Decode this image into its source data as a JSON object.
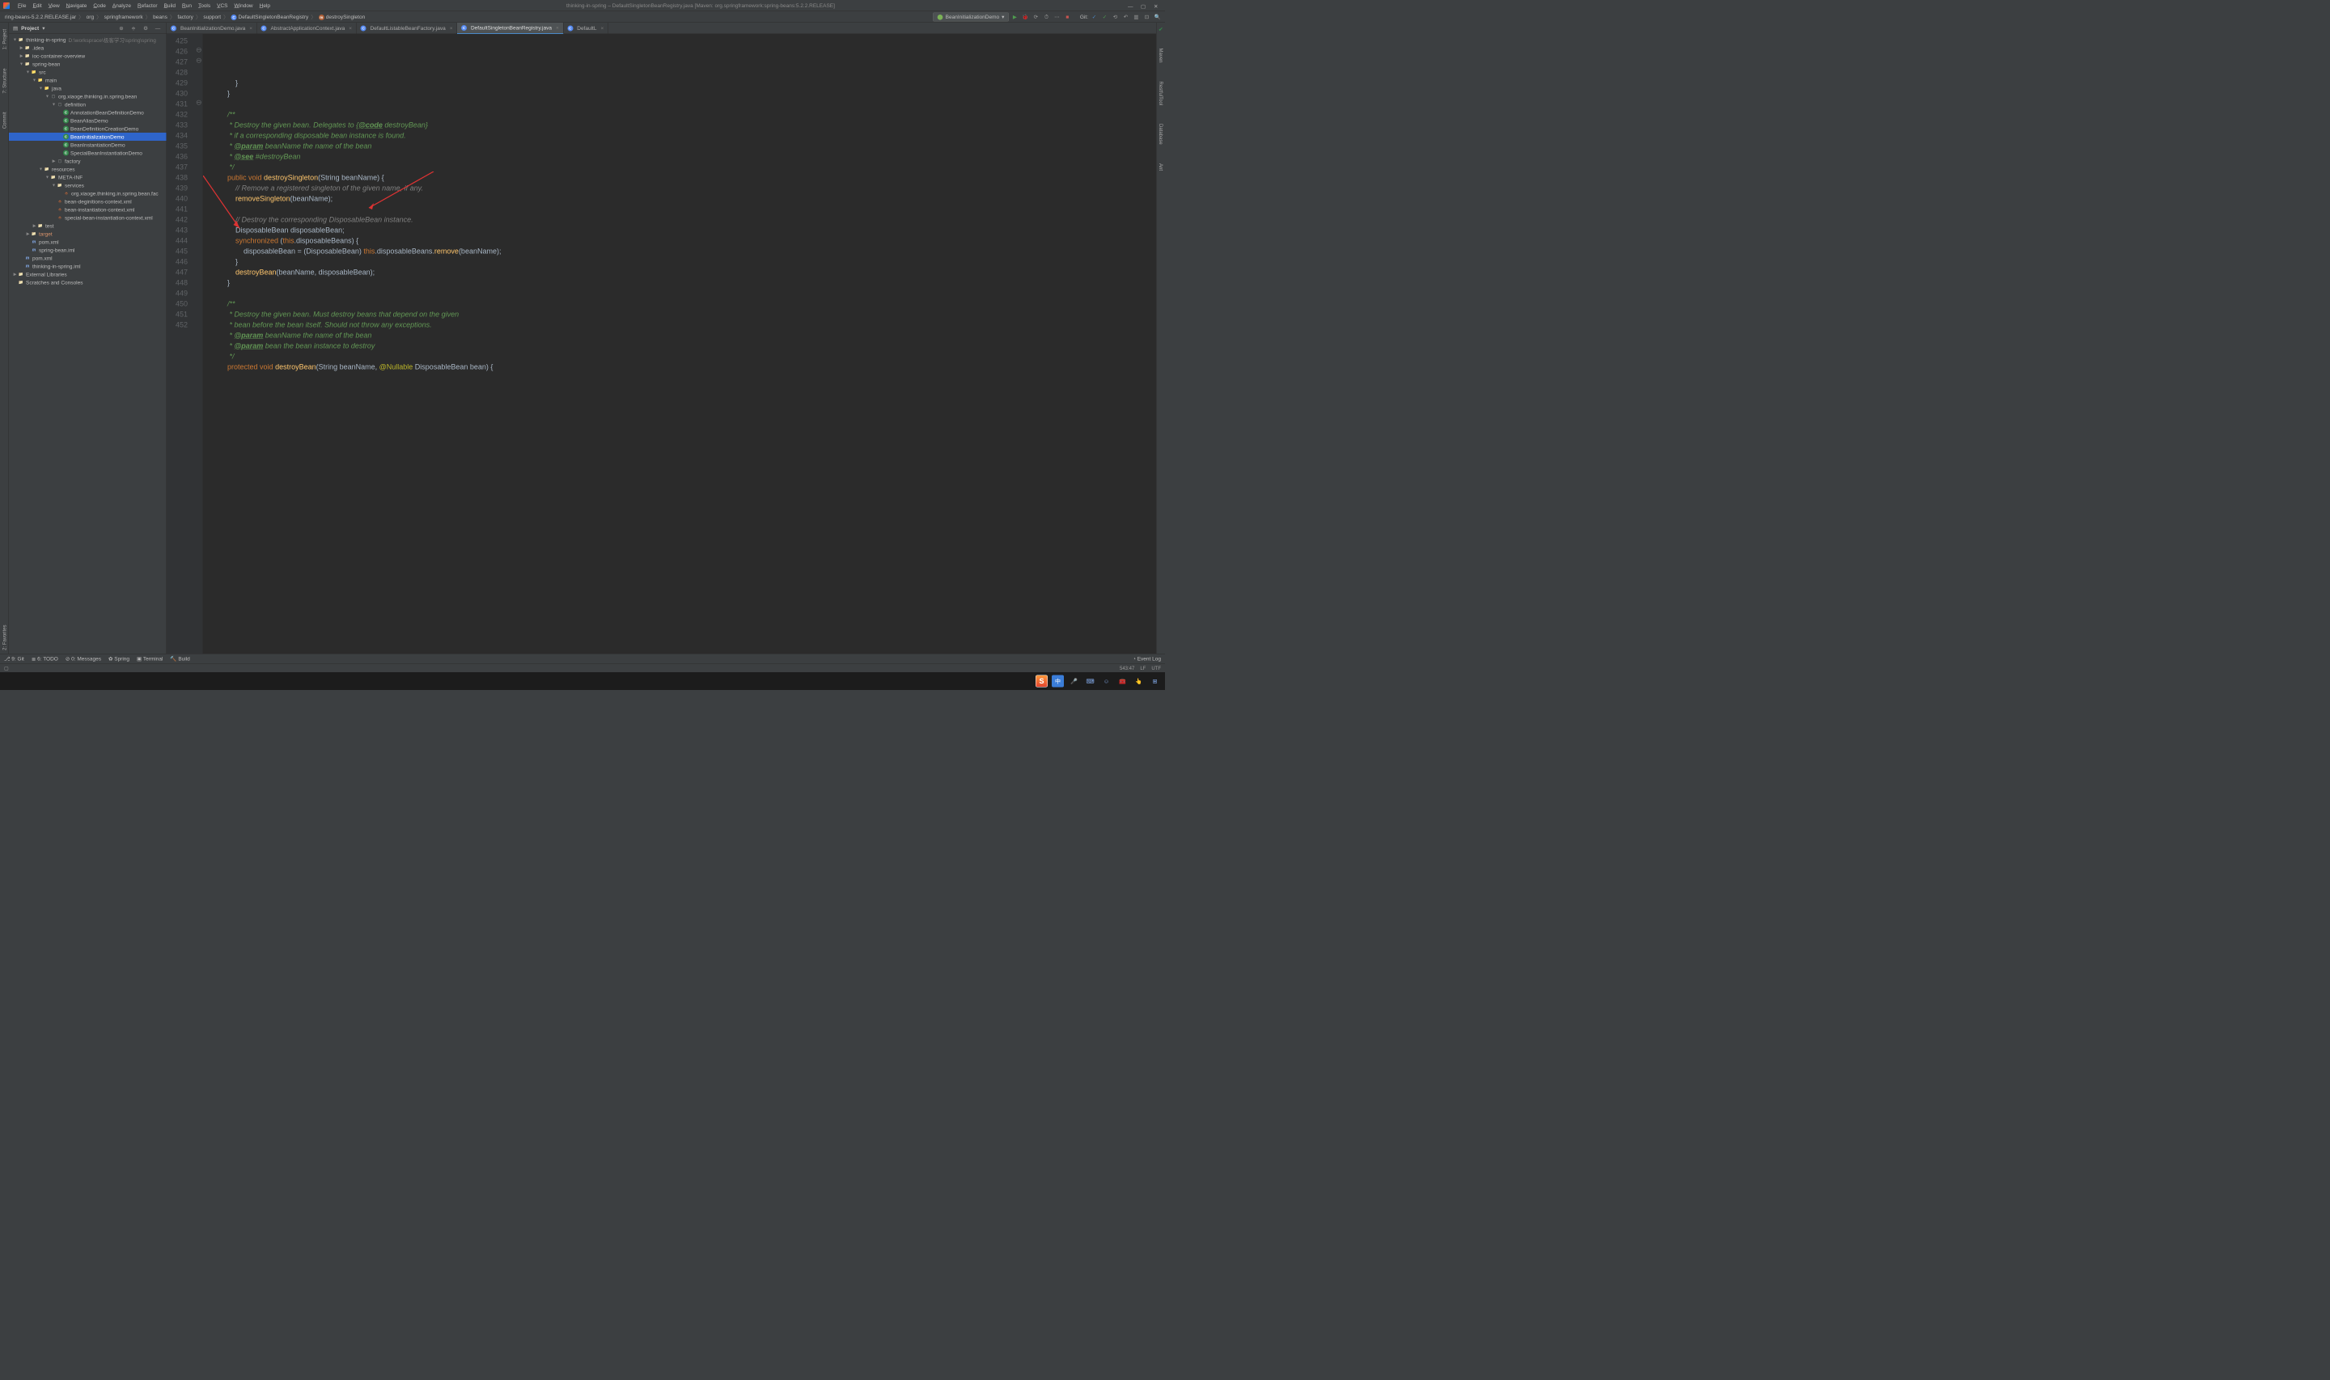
{
  "title": "thinking-in-spring – DefaultSingletonBeanRegistry.java [Maven: org.springframework:spring-beans:5.2.2.RELEASE]",
  "menu": [
    "File",
    "Edit",
    "View",
    "Navigate",
    "Code",
    "Analyze",
    "Refactor",
    "Build",
    "Run",
    "Tools",
    "VCS",
    "Window",
    "Help"
  ],
  "breadcrumbs": [
    "ring-beans-5.2.2.RELEASE.jar",
    "org",
    "springframework",
    "beans",
    "factory",
    "support",
    "DefaultSingletonBeanRegistry",
    "destroySingleton"
  ],
  "run_config": "BeanInitializationDemo",
  "vcs_label": "Git:",
  "project_panel": {
    "title": "Project"
  },
  "left_tabs": [
    "1: Project",
    "7: Structure",
    "Commit",
    "2: Favorites"
  ],
  "right_tabs": [
    "Maven",
    "RestfulTool",
    "Database",
    "Ant"
  ],
  "tree": [
    {
      "d": 0,
      "ar": "▼",
      "ic": "folder",
      "label": "thinking-in-spring",
      "path": "D:\\worksprace\\极客学习\\spring\\spring"
    },
    {
      "d": 1,
      "ar": "▶",
      "ic": "folder",
      "label": ".idea"
    },
    {
      "d": 1,
      "ar": "▶",
      "ic": "folder",
      "label": "ioc-container-overview"
    },
    {
      "d": 1,
      "ar": "▼",
      "ic": "folder",
      "label": "spring-bean"
    },
    {
      "d": 2,
      "ar": "▼",
      "ic": "folder-blue",
      "label": "src"
    },
    {
      "d": 3,
      "ar": "▼",
      "ic": "folder-blue",
      "label": "main"
    },
    {
      "d": 4,
      "ar": "▼",
      "ic": "folder-blue",
      "label": "java"
    },
    {
      "d": 5,
      "ar": "▼",
      "ic": "pkg",
      "label": "org.xiaoge.thinking.in.spring.bean"
    },
    {
      "d": 6,
      "ar": "▼",
      "ic": "pkg",
      "label": "definition"
    },
    {
      "d": 7,
      "ar": "",
      "ic": "cls",
      "label": "AnnotationBeanDefinitionDemo"
    },
    {
      "d": 7,
      "ar": "",
      "ic": "cls",
      "label": "BeanAliasDemo"
    },
    {
      "d": 7,
      "ar": "",
      "ic": "cls",
      "label": "BeanDefinitionCreationDemo"
    },
    {
      "d": 7,
      "ar": "",
      "ic": "cls",
      "label": "BeanInitializationDemo",
      "sel": true
    },
    {
      "d": 7,
      "ar": "",
      "ic": "cls",
      "label": "BeanInstantiationDemo"
    },
    {
      "d": 7,
      "ar": "",
      "ic": "cls",
      "label": "SpecialBeanInstantiationDemo"
    },
    {
      "d": 6,
      "ar": "▶",
      "ic": "pkg",
      "label": "factory"
    },
    {
      "d": 4,
      "ar": "▼",
      "ic": "folder",
      "label": "resources"
    },
    {
      "d": 5,
      "ar": "▼",
      "ic": "folder",
      "label": "META-INF"
    },
    {
      "d": 6,
      "ar": "▼",
      "ic": "folder",
      "label": "services"
    },
    {
      "d": 7,
      "ar": "",
      "ic": "xml",
      "label": "org.xiaoge.thinking.in.spring.bean.fac"
    },
    {
      "d": 6,
      "ar": "",
      "ic": "xml",
      "label": "bean-deginitions-context.xml"
    },
    {
      "d": 6,
      "ar": "",
      "ic": "xml",
      "label": "bean-instantiation-context.xml"
    },
    {
      "d": 6,
      "ar": "",
      "ic": "xml",
      "label": "special-bean-instantiation-context.xml"
    },
    {
      "d": 3,
      "ar": "▶",
      "ic": "folder",
      "label": "test"
    },
    {
      "d": 2,
      "ar": "▶",
      "ic": "folder",
      "label": "target",
      "target": true
    },
    {
      "d": 2,
      "ar": "",
      "ic": "file",
      "label": "pom.xml"
    },
    {
      "d": 2,
      "ar": "",
      "ic": "file",
      "label": "spring-bean.iml"
    },
    {
      "d": 1,
      "ar": "",
      "ic": "file",
      "label": "pom.xml"
    },
    {
      "d": 1,
      "ar": "",
      "ic": "file",
      "label": "thinking-in-spring.iml"
    },
    {
      "d": 0,
      "ar": "▶",
      "ic": "folder",
      "label": "External Libraries"
    },
    {
      "d": 0,
      "ar": "",
      "ic": "folder",
      "label": "Scratches and Consoles"
    }
  ],
  "editor_tabs": [
    {
      "label": "BeanInitializationDemo.java",
      "icon": "class"
    },
    {
      "label": "AbstractApplicationContext.java",
      "icon": "class"
    },
    {
      "label": "DefaultListableBeanFactory.java",
      "icon": "class"
    },
    {
      "label": "DefaultSingletonBeanRegistry.java",
      "icon": "class",
      "active": true
    },
    {
      "label": "DefaultL",
      "icon": "class"
    }
  ],
  "first_line": 425,
  "chart_data": {
    "type": "code",
    "language": "java",
    "lines": [
      "            }",
      "        }",
      "",
      "        /**",
      "         * Destroy the given bean. Delegates to {@code destroyBean}",
      "         * if a corresponding disposable bean instance is found.",
      "         * @param beanName the name of the bean",
      "         * @see #destroyBean",
      "         */",
      "        public void destroySingleton(String beanName) {",
      "            // Remove a registered singleton of the given name, if any.",
      "            removeSingleton(beanName);",
      "",
      "            // Destroy the corresponding DisposableBean instance.",
      "            DisposableBean disposableBean;",
      "            synchronized (this.disposableBeans) {",
      "                disposableBean = (DisposableBean) this.disposableBeans.remove(beanName);",
      "            }",
      "            destroyBean(beanName, disposableBean);",
      "        }",
      "",
      "        /**",
      "         * Destroy the given bean. Must destroy beans that depend on the given",
      "         * bean before the bean itself. Should not throw any exceptions.",
      "         * @param beanName the name of the bean",
      "         * @param bean the bean instance to destroy",
      "         */",
      "        protected void destroyBean(String beanName, @Nullable DisposableBean bean) {"
    ]
  },
  "bottom_tabs": [
    "9: Git",
    "6: TODO",
    "0: Messages",
    "Spring",
    "Terminal",
    "Build"
  ],
  "status": {
    "event_log": "Event Log",
    "pos": "543:47",
    "le": "LF",
    "enc": "UTF"
  }
}
